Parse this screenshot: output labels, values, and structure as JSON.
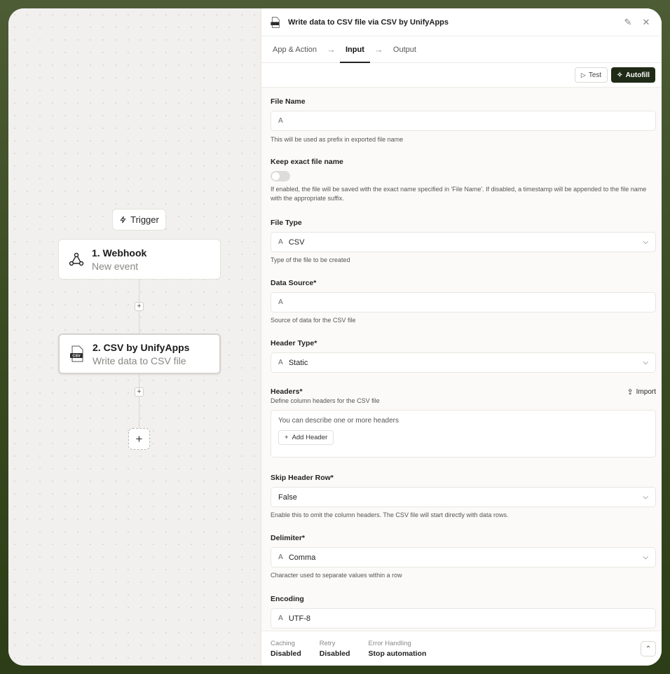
{
  "canvas": {
    "trigger_label": "Trigger",
    "nodes": [
      {
        "title": "1. Webhook",
        "subtitle": "New event",
        "icon": "webhook-icon"
      },
      {
        "title": "2. CSV by UnifyApps",
        "subtitle": "Write data to CSV file",
        "icon": "csv-file-icon"
      }
    ]
  },
  "panel": {
    "title": "Write data to CSV file via CSV by UnifyApps",
    "tabs": [
      {
        "label": "App & Action"
      },
      {
        "label": "Input"
      },
      {
        "label": "Output"
      }
    ],
    "active_tab": "Input",
    "toolbar": {
      "test_label": "Test",
      "autofill_label": "Autofill"
    },
    "fields": {
      "file_name": {
        "label": "File Name",
        "value": "",
        "help": "This will be used as prefix in exported file name"
      },
      "keep_exact": {
        "label": "Keep exact file name",
        "enabled": false,
        "help": "If enabled, the file will be saved with the exact name specified in 'File Name'. If disabled, a timestamp will be appended to the file name with the appropriate suffix."
      },
      "file_type": {
        "label": "File Type",
        "value": "CSV",
        "help": "Type of the file to be created"
      },
      "data_source": {
        "label": "Data Source*",
        "value": "",
        "help": "Source of data for the CSV file"
      },
      "header_type": {
        "label": "Header Type*",
        "value": "Static"
      },
      "headers": {
        "label": "Headers*",
        "help": "Define column headers for the CSV file",
        "import_label": "Import",
        "placeholder": "You can describe one or more headers",
        "add_label": "Add Header"
      },
      "skip_header": {
        "label": "Skip Header Row*",
        "value": "False",
        "help": "Enable this to omit the column headers. The CSV file will start directly with data rows."
      },
      "delimiter": {
        "label": "Delimiter*",
        "value": "Comma",
        "help": "Character used to separate values within a row"
      },
      "encoding": {
        "label": "Encoding",
        "value": "UTF-8"
      }
    },
    "footer": [
      {
        "key": "Caching",
        "value": "Disabled"
      },
      {
        "key": "Retry",
        "value": "Disabled"
      },
      {
        "key": "Error Handling",
        "value": "Stop automation"
      }
    ]
  }
}
